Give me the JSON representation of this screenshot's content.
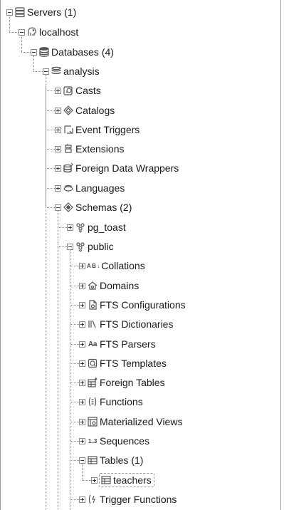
{
  "tree": [
    {
      "label": "Servers (1)",
      "icon": "servers-icon",
      "expanded": true
    },
    {
      "label": "localhost",
      "icon": "elephant-icon",
      "expanded": true
    },
    {
      "label": "Databases (4)",
      "icon": "databases-icon",
      "expanded": true
    },
    {
      "label": "analysis",
      "icon": "database-icon",
      "expanded": true
    },
    {
      "label": "Casts",
      "icon": "casts-icon",
      "expanded": false
    },
    {
      "label": "Catalogs",
      "icon": "catalog-icon",
      "expanded": false
    },
    {
      "label": "Event Triggers",
      "icon": "event-trigger-icon",
      "expanded": false
    },
    {
      "label": "Extensions",
      "icon": "extension-icon",
      "expanded": false
    },
    {
      "label": "Foreign Data Wrappers",
      "icon": "foreign-data-wrapper-icon",
      "expanded": false
    },
    {
      "label": "Languages",
      "icon": "language-icon",
      "expanded": false
    },
    {
      "label": "Schemas (2)",
      "icon": "schema-icon",
      "expanded": true
    },
    {
      "label": "pg_toast",
      "icon": "schema-grid-icon",
      "expanded": false
    },
    {
      "label": "public",
      "icon": "schema-grid-icon",
      "expanded": true
    },
    {
      "label": "Collations",
      "icon": "collation-icon",
      "icon_text": "A B ↓",
      "expanded": false
    },
    {
      "label": "Domains",
      "icon": "domain-icon",
      "expanded": false
    },
    {
      "label": "FTS Configurations",
      "icon": "fts-config-icon",
      "expanded": false
    },
    {
      "label": "FTS Dictionaries",
      "icon": "fts-dictionary-icon",
      "expanded": false
    },
    {
      "label": "FTS Parsers",
      "icon": "fts-parser-icon",
      "icon_text": "Aa",
      "expanded": false
    },
    {
      "label": "FTS Templates",
      "icon": "fts-template-icon",
      "expanded": false
    },
    {
      "label": "Foreign Tables",
      "icon": "foreign-table-icon",
      "expanded": false
    },
    {
      "label": "Functions",
      "icon": "function-icon",
      "expanded": false
    },
    {
      "label": "Materialized Views",
      "icon": "materialized-view-icon",
      "expanded": false
    },
    {
      "label": "Sequences",
      "icon": "sequence-icon",
      "icon_text": "1..3",
      "expanded": false
    },
    {
      "label": "Tables (1)",
      "icon": "tables-icon",
      "expanded": true
    },
    {
      "label": "teachers",
      "icon": "table-icon",
      "expanded": false,
      "selected": true
    },
    {
      "label": "Trigger Functions",
      "icon": "trigger-function-icon",
      "expanded": false
    }
  ],
  "colors": {
    "text": "#1a1a1a",
    "icon": "#555555",
    "tree_line": "#8a8a8a",
    "selection_border": "#9a9a9a"
  }
}
